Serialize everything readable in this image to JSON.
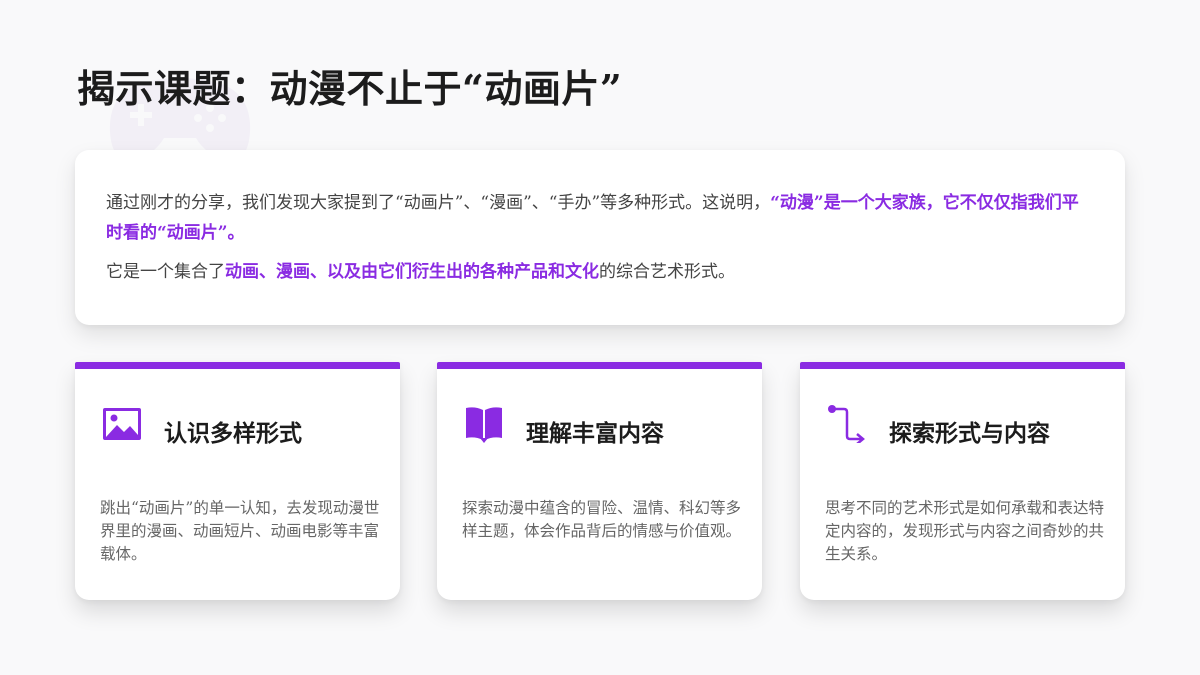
{
  "title": "揭示课题：动漫不止于“动画片”",
  "intro": {
    "p1_a": "通过刚才的分享，我们发现大家提到了“动画片”、“漫画”、“手办”等多种形式。这说明，",
    "p1_b": "“动漫”是一个大家族，它不仅仅指我们平时看的“动画片”。",
    "p2_a": "它是一个集合了",
    "p2_b": "动画、漫画、以及由它们衍生出的各种产品和文化",
    "p2_c": "的综合艺术形式。"
  },
  "cards": [
    {
      "icon": "image-icon",
      "title": "认识多样形式",
      "desc": "跳出“动画片”的单一认知，去发现动漫世界里的漫画、动画短片、动画电影等丰富载体。"
    },
    {
      "icon": "book-icon",
      "title": "理解丰富内容",
      "desc": "探索动漫中蕴含的冒险、温情、科幻等多样主题，体会作品背后的情感与价值观。"
    },
    {
      "icon": "route-icon",
      "title": "探索形式与内容",
      "desc": "思考不同的艺术形式是如何承载和表达特定内容的，发现形式与内容之间奇妙的共生关系。"
    }
  ],
  "colors": {
    "accent": "#8a2be2",
    "background": "#f9f9fa",
    "card": "#ffffff",
    "title": "#1c1c1c",
    "body_text": "#444444",
    "muted_text": "#666666",
    "watermark": "#e6dff1"
  }
}
